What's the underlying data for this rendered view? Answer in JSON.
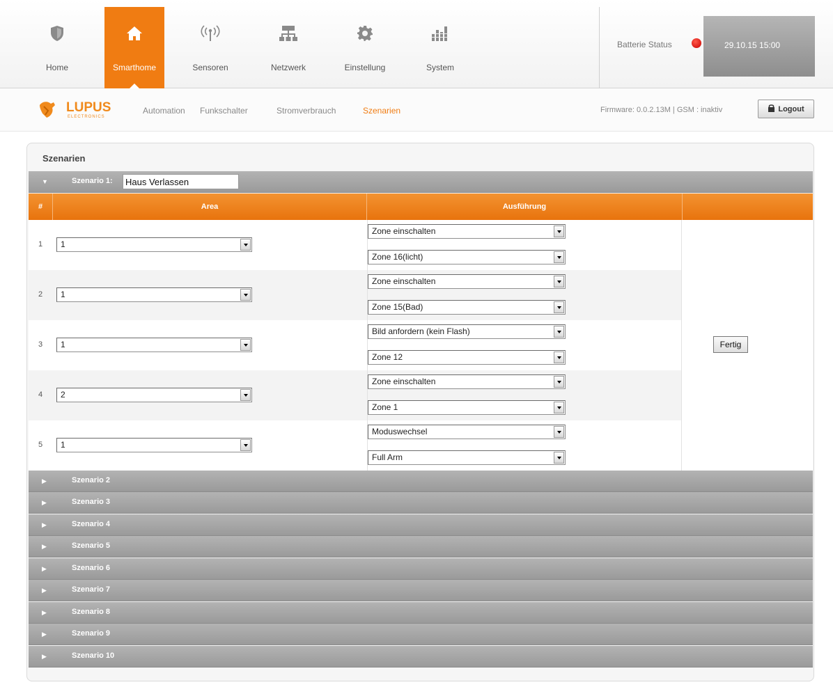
{
  "nav": {
    "items": [
      {
        "label": "Home",
        "icon": "shield-icon"
      },
      {
        "label": "Smarthome",
        "icon": "house-icon"
      },
      {
        "label": "Sensoren",
        "icon": "signal-icon"
      },
      {
        "label": "Netzwerk",
        "icon": "network-icon"
      },
      {
        "label": "Einstellung",
        "icon": "gear-icon"
      },
      {
        "label": "System",
        "icon": "bars-icon"
      }
    ],
    "active": "Smarthome",
    "accent_color": "#f07c12"
  },
  "status": {
    "battery_label": "Batterie Status",
    "battery_color": "#d60000",
    "datetime": "29.10.15 15:00"
  },
  "subnav": {
    "logo_text": "LUPUS",
    "logo_subtext": "ELECTRONICS",
    "items": [
      "Automation",
      "Funkschalter",
      "Stromverbrauch",
      "Szenarien"
    ],
    "active": "Szenarien",
    "firmware": "Firmware: 0.0.2.13M | GSM : inaktiv",
    "logout_label": "Logout"
  },
  "panel": {
    "title": "Szenarien",
    "scenario1": {
      "label": "Szenario 1:",
      "name": "Haus Verlassen"
    },
    "table": {
      "headers": [
        "#",
        "Area",
        "Ausführung"
      ],
      "rows": [
        {
          "num": "1",
          "area": "1",
          "action": "Zone einschalten",
          "target": "Zone 16(licht)"
        },
        {
          "num": "2",
          "area": "1",
          "action": "Zone einschalten",
          "target": "Zone 15(Bad)"
        },
        {
          "num": "3",
          "area": "1",
          "action": "Bild anfordern (kein Flash)",
          "target": "Zone 12"
        },
        {
          "num": "4",
          "area": "2",
          "action": "Zone einschalten",
          "target": "Zone 1"
        },
        {
          "num": "5",
          "area": "1",
          "action": "Moduswechsel",
          "target": "Full Arm"
        }
      ],
      "done_label": "Fertig"
    },
    "collapsed_scenarios": [
      "Szenario 2",
      "Szenario 3",
      "Szenario 4",
      "Szenario 5",
      "Szenario 6",
      "Szenario 7",
      "Szenario 8",
      "Szenario 9",
      "Szenario 10"
    ]
  }
}
